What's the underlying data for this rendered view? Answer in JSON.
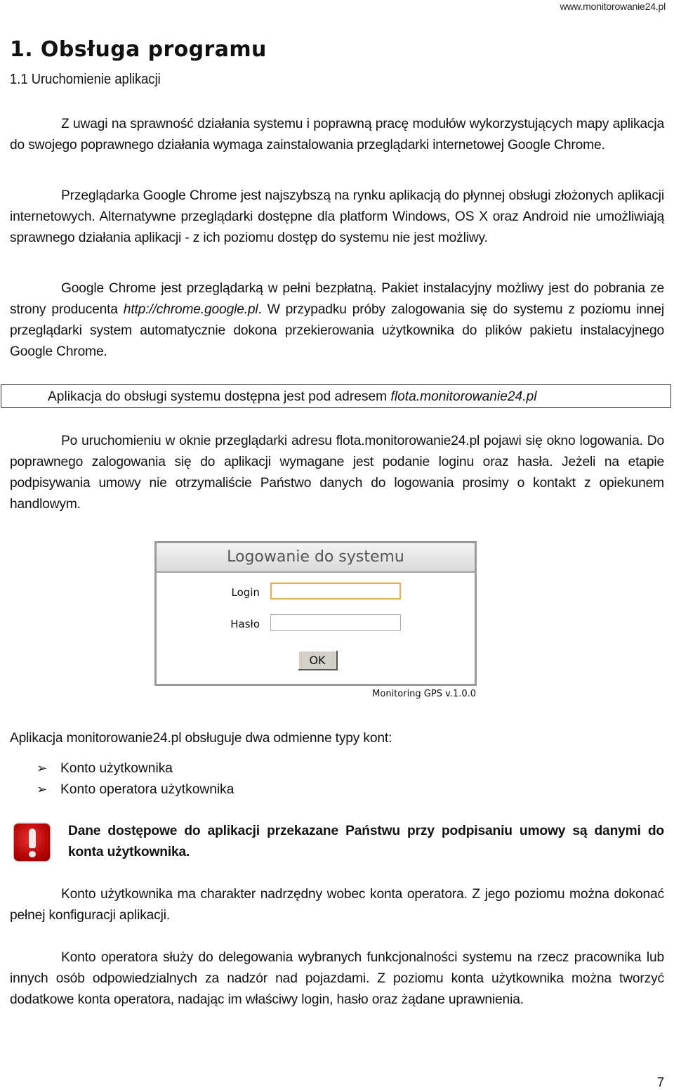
{
  "header": {
    "site_url": "www.monitorowanie24.pl"
  },
  "title": "1. Obsługa programu",
  "section": "1.1 Uruchomienie aplikacji",
  "paragraphs": {
    "p1": "Z uwagi na sprawność działania systemu i poprawną pracę modułów wykorzystujących mapy aplikacja do swojego poprawnego działania wymaga zainstalowania przeglądarki internetowej Google Chrome.",
    "p2": "Przeglądarka Google Chrome jest najszybszą na rynku aplikacją do płynnej obsługi złożonych aplikacji internetowych. Alternatywne przeglądarki dostępne dla platform Windows, OS X oraz Android nie umożliwiają sprawnego działania aplikacji - z ich poziomu dostęp do systemu nie jest możliwy.",
    "p3_before": "Google Chrome jest przeglądarką w pełni bezpłatną. Pakiet instalacyjny możliwy jest do pobrania ze strony producenta ",
    "p3_link": "http://chrome.google.pl",
    "p3_after": ". W przypadku próby zalogowania się do systemu z poziomu innej przeglądarki system automatycznie dokona przekierowania użytkownika do plików pakietu instalacyjnego Google Chrome.",
    "boxed_text": "Aplikacja do obsługi systemu dostępna jest pod adresem ",
    "boxed_link": "flota.monitorowanie24.pl",
    "p4": "Po uruchomieniu w oknie przeglądarki adresu flota.monitorowanie24.pl pojawi się okno logowania. Do poprawnego zalogowania się do aplikacji wymagane jest podanie loginu oraz hasła. Jeżeli na etapie podpisywania umowy nie otrzymaliście Państwo danych do logowania prosimy o kontakt z opiekunem handlowym.",
    "p5": "Aplikacja monitorowanie24.pl obsługuje dwa odmienne typy kont:",
    "warning": "Dane dostępowe do aplikacji przekazane Państwu przy podpisaniu umowy są danymi do konta użytkownika.",
    "p6": "Konto użytkownika ma charakter nadrzędny wobec konta operatora. Z jego poziomu można dokonać pełnej konfiguracji aplikacji.",
    "p7": "Konto operatora służy do delegowania wybranych funkcjonalności systemu na rzecz pracownika lub innych osób odpowiedzialnych za nadzór nad pojazdami. Z poziomu  konta użytkownika można tworzyć dodatkowe konta operatora, nadając im właściwy login, hasło oraz żądane uprawnienia."
  },
  "login_dialog": {
    "title": "Logowanie do systemu",
    "login_label": "Login",
    "login_value": "",
    "password_label": "Hasło",
    "password_value": "",
    "ok_label": "OK",
    "version": "Monitoring GPS v.1.0.0"
  },
  "account_types": [
    {
      "icon": "arrow-bullet-icon",
      "glyph": "➢",
      "label": "Konto użytkownika"
    },
    {
      "icon": "arrow-bullet-icon",
      "glyph": "➢",
      "label": "Konto operatora użytkownika"
    }
  ],
  "warning_icon": "exclamation-icon",
  "colors": {
    "warning_red": "#c00000",
    "input_focus": "#e0b45a",
    "button_face": "#d4d0c8"
  },
  "page_number": "7"
}
